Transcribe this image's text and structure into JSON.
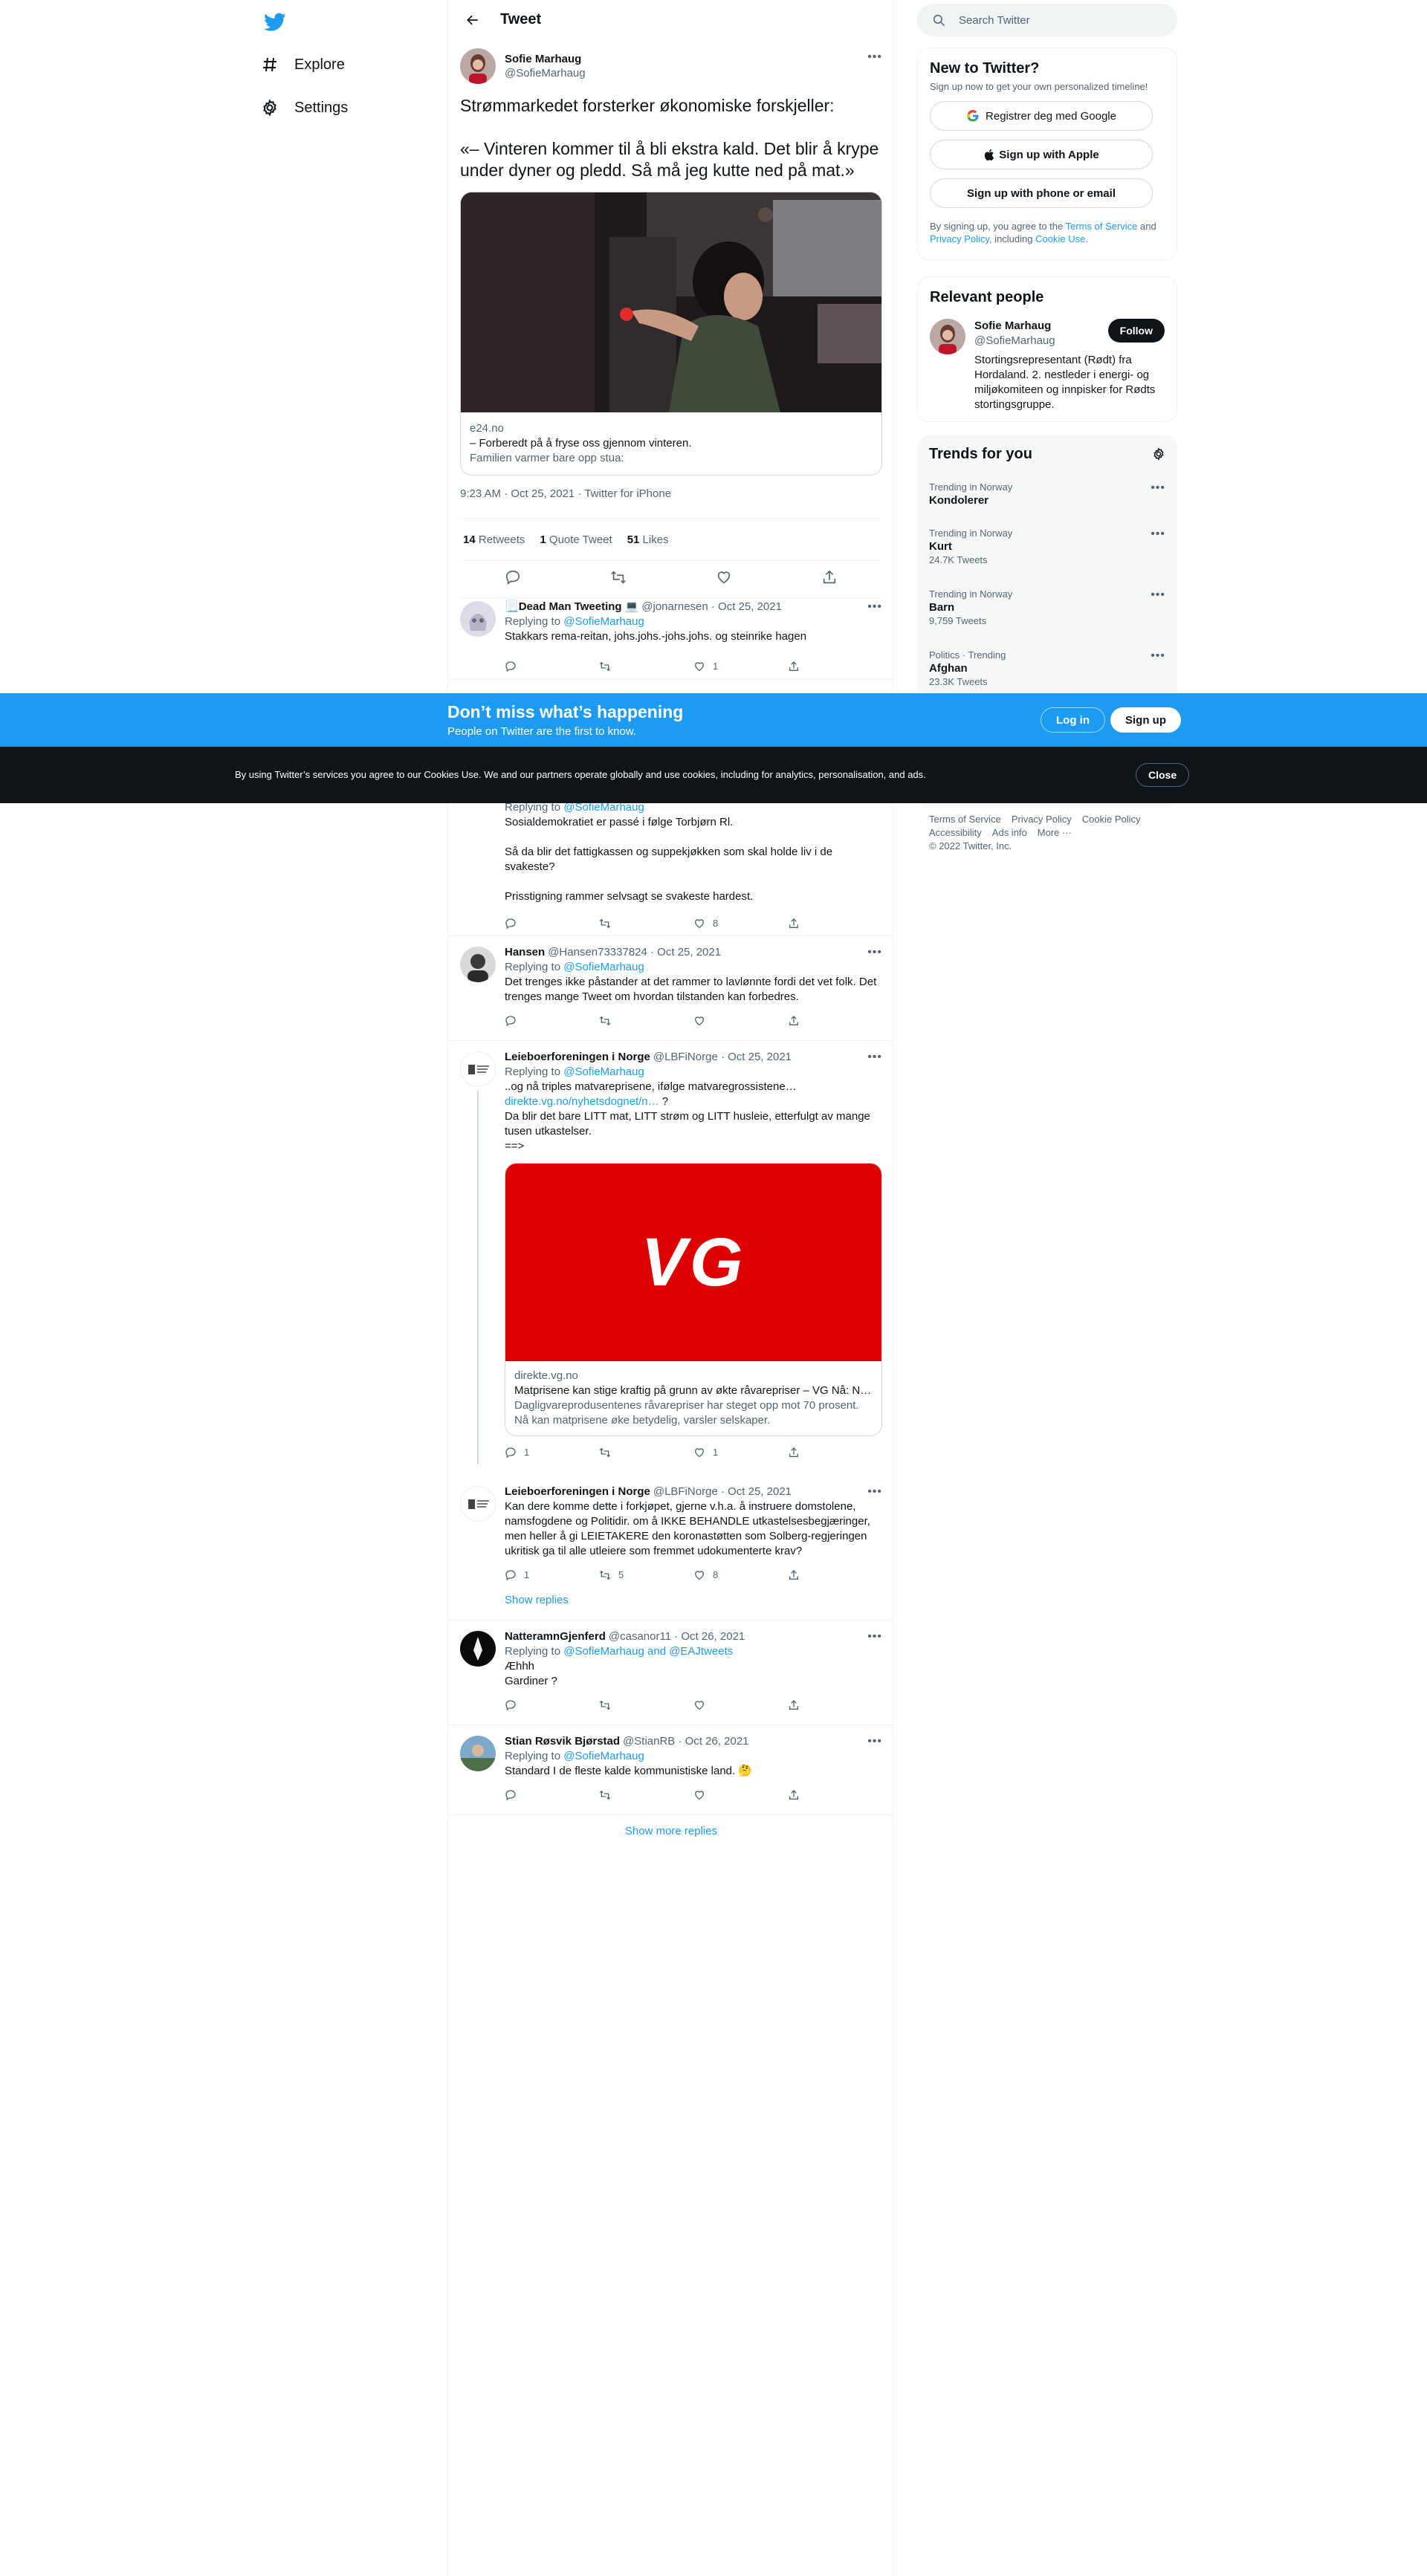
{
  "nav": {
    "explore": "Explore",
    "settings": "Settings"
  },
  "header": {
    "title": "Tweet"
  },
  "focal": {
    "name": "Sofie Marhaug",
    "handle": "@SofieMarhaug",
    "text": "Strømmarkedet forsterker økonomiske forskjeller:\n\n«– Vinteren kommer til å bli ekstra kald. Det blir å krype under dyner og pledd. Så må jeg kutte ned på mat.»",
    "card_domain": "e24.no",
    "card_title": "– Forberedt på å fryse oss gjennom vinteren.",
    "card_desc": "Familien varmer bare opp stua:",
    "time": "9:23 AM · Oct 25, 2021 · Twitter for iPhone",
    "retweets_n": "14",
    "retweets_l": "Retweets",
    "quotes_n": "1",
    "quotes_l": "Quote Tweet",
    "likes_n": "51",
    "likes_l": "Likes"
  },
  "replies": [
    {
      "name": "Dead Man Tweeting",
      "handle": "@jonarnesen · Oct 25, 2021",
      "replying": "Replying to",
      "to": "@SofieMarhaug",
      "text": "Stakkars rema-reitan, johs.johs.-johs.johs. og steinrike hagen",
      "likes": "1"
    },
    {
      "replying": "Replying to",
      "to": "@SofieMarhaug",
      "text": "Sosialdemokratiet er passé i følge Torbjørn Rl.\n\nSå da blir det fattigkassen og suppekjøkken som skal holde liv i de svakeste?\n\nPrisstigning rammer selvsagt se svakeste hardest.",
      "likes": "8"
    },
    {
      "name": "Hansen",
      "handle": "@Hansen73337824 · Oct 25, 2021",
      "replying": "Replying to",
      "to": "@SofieMarhaug",
      "text": "Det trenges ikke påstander at det rammer to lavlønnte fordi det vet folk. Det trenges mange Tweet om hvordan tilstanden kan forbedres."
    },
    {
      "name": "Leieboerforeningen i Norge",
      "handle": "@LBFiNorge · Oct 25, 2021",
      "replying": "Replying to",
      "to": "@SofieMarhaug",
      "text1": "..og nå triples matvareprisene, ifølge matvaregrossistene…",
      "link": "direkte.vg.no/nyhetsdognet/n…",
      "link_after": " ?",
      "text2": "Da blir det bare LITT mat, LITT strøm og LITT husleie, etterfulgt av mange tusen utkastelser.\n==>",
      "card_logo": "VG",
      "card_domain": "direkte.vg.no",
      "card_title": "Matprisene kan stige kraftig på grunn av økte råvarepriser – VG Nå: N…",
      "card_desc": "Dagligvareprodusentenes råvarepriser har steget opp mot 70 prosent. Nå kan matprisene øke betydelig, varsler selskaper.",
      "replies": "1",
      "likes": "1"
    },
    {
      "name": "Leieboerforeningen i Norge",
      "handle": "@LBFiNorge · Oct 25, 2021",
      "text": "Kan dere komme dette i forkjøpet, gjerne v.h.a. å instruere domstolene, namsfogdene og Politidir. om å IKKE BEHANDLE utkastelsesbegjæringer, men heller å gi LEIETAKERE den koronastøtten som Solberg-regjeringen ukritisk ga til alle utleiere som fremmet udokumenterte krav?",
      "replies": "1",
      "retweets": "5",
      "likes": "8",
      "show_replies": "Show replies"
    },
    {
      "name": "NatteramnGjenferd",
      "handle": "@casanor11 · Oct 26, 2021",
      "replying": "Replying to",
      "to": "@SofieMarhaug and @EAJtweets",
      "text": "Æhhh\nGardiner ?"
    },
    {
      "name": "Stian Røsvik Bjørstad",
      "handle": "@StianRB · Oct 26, 2021",
      "replying": "Replying to",
      "to": "@SofieMarhaug",
      "text": "Standard I de fleste kalde kommunistiske land. 🤔"
    }
  ],
  "show_more": "Show more replies",
  "search": {
    "placeholder": "Search Twitter"
  },
  "new_to_twitter": {
    "title": "New to Twitter?",
    "sub": "Sign up now to get your own personalized timeline!",
    "google": "Registrer deg med Google",
    "apple": "Sign up with Apple",
    "phone": "Sign up with phone or email",
    "legal_1": "By signing up, you agree to the ",
    "terms": "Terms of Service",
    "legal_2": " and ",
    "privacy": "Privacy Policy",
    "legal_3": ", including ",
    "cookie": "Cookie Use",
    "legal_4": "."
  },
  "relevant": {
    "title": "Relevant people",
    "name": "Sofie Marhaug",
    "handle": "@SofieMarhaug",
    "bio": "Stortingsrepresentant (Rødt) fra Hordaland. 2. nestleder i energi- og miljøkomiteen og innpisker for Rødts stortingsgruppe.",
    "follow": "Follow"
  },
  "trends": {
    "title": "Trends for you",
    "items": [
      {
        "ctx": "Trending in Norway",
        "name": "Kondolerer",
        "count": ""
      },
      {
        "ctx": "Trending in Norway",
        "name": "Kurt",
        "count": "24.7K Tweets"
      },
      {
        "ctx": "Trending in Norway",
        "name": "Barn",
        "count": "9,759 Tweets"
      },
      {
        "ctx": "Politics · Trending",
        "name": "Afghan",
        "count": "23.3K Tweets"
      }
    ]
  },
  "footer": {
    "l1": "Terms of Service",
    "l2": "Privacy Policy",
    "l3": "Cookie Policy",
    "l4": "Accessibility",
    "l5": "Ads info",
    "l6": "More ···",
    "copy": "© 2022 Twitter, Inc."
  },
  "banner": {
    "title": "Don’t miss what’s happening",
    "sub": "People on Twitter are the first to know.",
    "login": "Log in",
    "signup": "Sign up"
  },
  "cookie": {
    "text": "By using Twitter’s services you agree to our Cookies Use. We and our partners operate globally and use cookies, including for analytics, personalisation, and ads.",
    "close": "Close"
  },
  "colors": {
    "accent": "#1d9bf0",
    "dark": "#0f1419",
    "muted": "#536471",
    "vg_red": "#dd0000"
  }
}
